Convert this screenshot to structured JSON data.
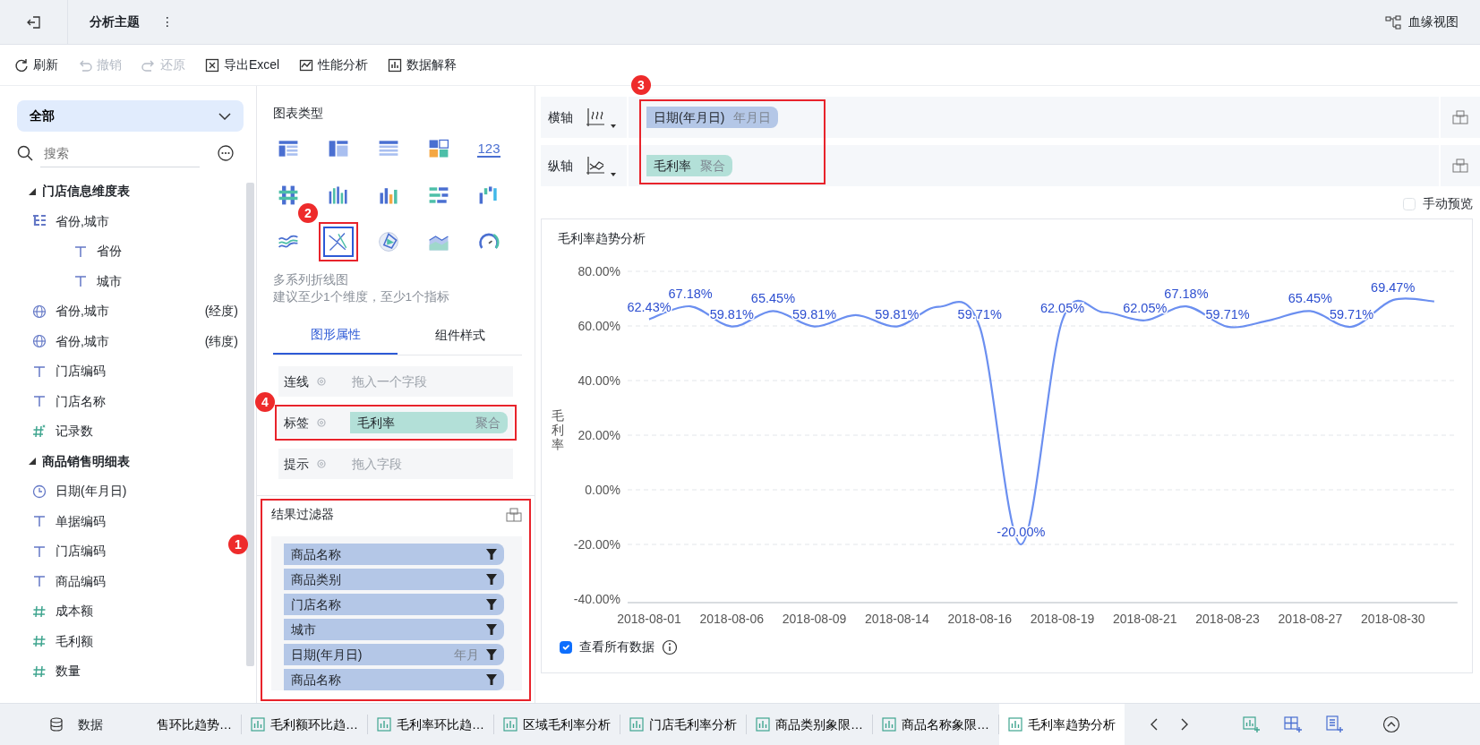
{
  "header": {
    "title": "分析主题",
    "menu": "⋮",
    "lineage": "血缘视图"
  },
  "toolbar": [
    {
      "label": "刷新",
      "kind": "refresh",
      "disabled": false
    },
    {
      "label": "撤销",
      "kind": "undo",
      "disabled": true
    },
    {
      "label": "还原",
      "kind": "redo",
      "disabled": true
    },
    {
      "label": "导出Excel",
      "kind": "excel",
      "disabled": false
    },
    {
      "label": "性能分析",
      "kind": "performance",
      "disabled": false
    },
    {
      "label": "数据解释",
      "kind": "explain",
      "disabled": false
    }
  ],
  "fields_panel": {
    "scope": "全部",
    "search": {
      "placeholder": "搜索"
    },
    "tables": [
      {
        "name": "门店信息维度表",
        "fields": [
          {
            "name": "省份,城市",
            "kind": "hierarchy",
            "children": [
              {
                "name": "省份",
                "kind": "text"
              },
              {
                "name": "城市",
                "kind": "text"
              }
            ]
          },
          {
            "name": "省份,城市",
            "kind": "geo",
            "suffix": "(经度)"
          },
          {
            "name": "省份,城市",
            "kind": "geo",
            "suffix": "(纬度)"
          },
          {
            "name": "门店编码",
            "kind": "text"
          },
          {
            "name": "门店名称",
            "kind": "text"
          },
          {
            "name": "记录数",
            "kind": "count"
          }
        ]
      },
      {
        "name": "商品销售明细表",
        "fields": [
          {
            "name": "日期(年月日)",
            "kind": "date"
          },
          {
            "name": "单据编码",
            "kind": "text"
          },
          {
            "name": "门店编码",
            "kind": "text"
          },
          {
            "name": "商品编码",
            "kind": "text"
          },
          {
            "name": "成本额",
            "kind": "number"
          },
          {
            "name": "毛利额",
            "kind": "number"
          },
          {
            "name": "数量",
            "kind": "number"
          }
        ]
      }
    ]
  },
  "chart_types": {
    "title": "图表类型",
    "items": [
      {
        "kind": "table",
        "selected": false
      },
      {
        "kind": "cross-table",
        "selected": false
      },
      {
        "kind": "detail-table",
        "selected": false
      },
      {
        "kind": "blocks",
        "selected": false
      },
      {
        "kind": "number",
        "text": "123",
        "selected": false
      },
      {
        "kind": "stacked-column",
        "selected": false
      },
      {
        "kind": "grouped-column",
        "selected": false
      },
      {
        "kind": "column",
        "selected": false
      },
      {
        "kind": "bar",
        "selected": false
      },
      {
        "kind": "waterfall",
        "selected": false
      },
      {
        "kind": "line",
        "selected": false
      },
      {
        "kind": "multi-line",
        "selected": true
      },
      {
        "kind": "radar",
        "selected": false
      },
      {
        "kind": "area",
        "selected": false
      },
      {
        "kind": "gauge",
        "selected": false
      }
    ],
    "description": "多系列折线图",
    "hint": "建议至少1个维度，至少1个指标"
  },
  "property_tabs": [
    {
      "label": "图形属性",
      "selected": true
    },
    {
      "label": "组件样式",
      "selected": false
    }
  ],
  "property_rows": [
    {
      "label": "连线",
      "hint": "拖入一个字段"
    },
    {
      "label": "标签",
      "field": {
        "name": "毛利率",
        "detail": "聚合",
        "kind": "measure"
      }
    },
    {
      "label": "提示",
      "hint": "拖入字段"
    }
  ],
  "result_filter": {
    "title": "结果过滤器",
    "items": [
      {
        "name": "商品名称"
      },
      {
        "name": "商品类别"
      },
      {
        "name": "门店名称"
      },
      {
        "name": "城市"
      },
      {
        "name": "日期(年月日)",
        "granularity": "年月"
      },
      {
        "name": "商品名称"
      }
    ]
  },
  "axes": [
    {
      "label": "横轴",
      "fields": [
        {
          "name": "日期(年月日)",
          "detail": "年月日",
          "kind": "dimension"
        }
      ]
    },
    {
      "label": "纵轴",
      "fields": [
        {
          "name": "毛利率",
          "detail": "聚合",
          "kind": "measure"
        }
      ]
    }
  ],
  "manual_preview": {
    "label": "手动预览",
    "checked": false
  },
  "chart": {
    "title": "毛利率趋势分析",
    "view_all": {
      "label": "查看所有数据",
      "checked": true
    },
    "chart_data": {
      "type": "line",
      "ylabel": "毛利率",
      "grid": true,
      "categories": [
        "2018-08-01",
        null,
        "2018-08-06",
        null,
        "2018-08-09",
        null,
        "2018-08-14",
        null,
        "2018-08-16",
        null,
        "2018-08-19",
        null,
        "2018-08-21",
        null,
        "2018-08-23",
        null,
        "2018-08-27",
        null,
        "2018-08-30",
        null
      ],
      "series": [
        {
          "color": "#6b8ff0",
          "values": [
            62.43,
            67.18,
            59.81,
            65.45,
            59.81,
            64,
            59.81,
            67,
            59.71,
            -20,
            62.05,
            65,
            62.05,
            67.18,
            59.71,
            62,
            65.45,
            59.71,
            69.47,
            69
          ]
        }
      ],
      "ylim": [
        -40,
        80
      ],
      "yticks": [
        {
          "value": 80,
          "label": "80.00%"
        },
        {
          "value": 60,
          "label": "60.00%"
        },
        {
          "value": 40,
          "label": "40.00%"
        },
        {
          "value": 20,
          "label": "20.00%"
        },
        {
          "value": 0,
          "label": "0.00%"
        },
        {
          "value": -20,
          "label": "-20.00%"
        },
        {
          "value": -40,
          "label": "-40.00%"
        }
      ],
      "value_labels": [
        "62.43%",
        "67.18%",
        "59.81%",
        "65.45%",
        "59.81%",
        null,
        "59.81%",
        null,
        "59.71%",
        "-20.00%",
        "62.05%",
        null,
        "62.05%",
        "67.18%",
        "59.71%",
        null,
        "65.45%",
        "59.71%",
        "69.47%",
        null
      ]
    }
  },
  "bottom_bar": {
    "data_tab": "数据",
    "sheets": [
      {
        "label": "售环比趋势…",
        "selected": false
      },
      {
        "label": "毛利额环比趋…",
        "selected": false
      },
      {
        "label": "毛利率环比趋…",
        "selected": false
      },
      {
        "label": "区域毛利率分析",
        "selected": false
      },
      {
        "label": "门店毛利率分析",
        "selected": false
      },
      {
        "label": "商品类别象限…",
        "selected": false
      },
      {
        "label": "商品名称象限…",
        "selected": false
      },
      {
        "label": "毛利率趋势分析",
        "selected": true
      }
    ]
  },
  "callouts": [
    {
      "number": "1"
    },
    {
      "number": "2"
    },
    {
      "number": "3"
    },
    {
      "number": "4"
    }
  ]
}
